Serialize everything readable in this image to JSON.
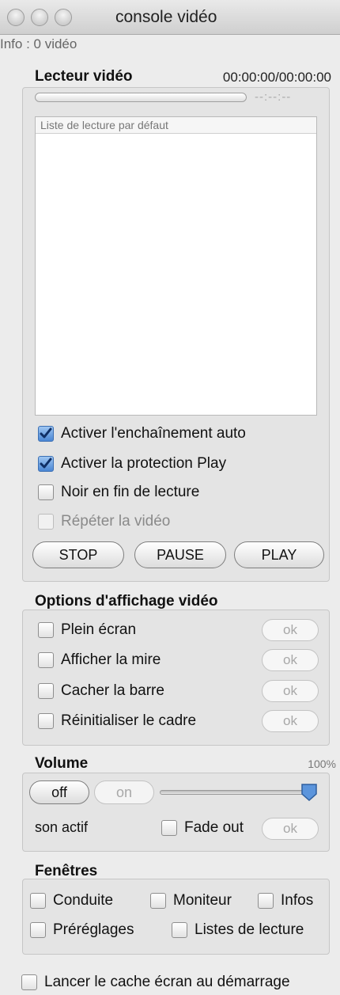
{
  "window": {
    "title": "console vidéo"
  },
  "info": "Info : 0 vidéo",
  "player": {
    "title": "Lecteur vidéo",
    "timecode": "00:00:00/00:00:00",
    "progress_fraction": 0,
    "remaining": "--:--:--",
    "playlist_header": "Liste de lecture par défaut",
    "options": [
      {
        "label": "Activer l'enchaînement auto",
        "checked": true
      },
      {
        "label": "Activer la protection Play",
        "checked": true
      },
      {
        "label": "Noir en fin de lecture",
        "checked": false
      },
      {
        "label": "Répéter la vidéo",
        "checked": false,
        "disabled": true
      }
    ],
    "buttons": {
      "stop": "STOP",
      "pause": "PAUSE",
      "play": "PLAY"
    }
  },
  "display_options": {
    "title": "Options d'affichage vidéo",
    "ok_label": "ok",
    "items": [
      {
        "label": "Plein écran",
        "checked": false
      },
      {
        "label": "Afficher la mire",
        "checked": false
      },
      {
        "label": "Cacher la barre",
        "checked": false
      },
      {
        "label": "Réinitialiser le cadre",
        "checked": false
      }
    ]
  },
  "volume": {
    "title": "Volume",
    "percent": "100%",
    "level_fraction": 1.0,
    "off_label": "off",
    "on_label": "on",
    "status": "son actif",
    "fade_out": "Fade out",
    "ok_label": "ok"
  },
  "windows": {
    "title": "Fenêtres",
    "items": [
      {
        "label": "Conduite",
        "checked": false
      },
      {
        "label": "Moniteur",
        "checked": false
      },
      {
        "label": "Infos",
        "checked": false
      },
      {
        "label": "Préréglages",
        "checked": false
      },
      {
        "label": "Listes de lecture",
        "checked": false
      }
    ]
  },
  "screensaver": {
    "label": "Lancer le cache écran au démarrage",
    "checked": false
  },
  "colors": {
    "accent": "#4a86d4",
    "background": "#ececec"
  }
}
